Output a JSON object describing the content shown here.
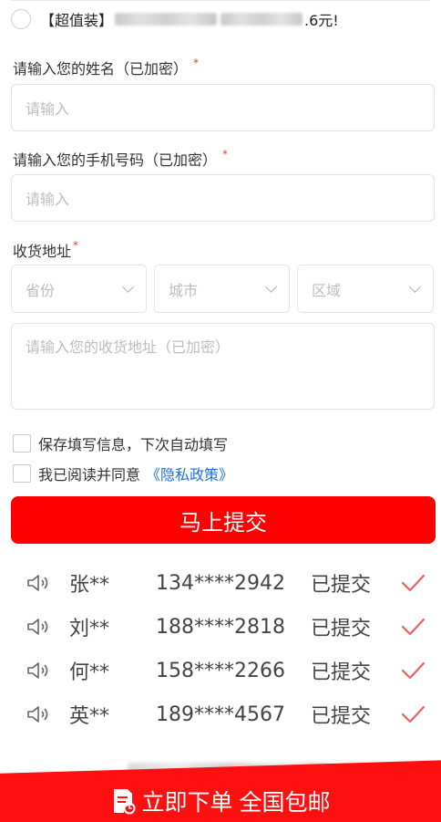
{
  "offer": {
    "prefix": "【超值装】",
    "suffix": ".6元!"
  },
  "form": {
    "name_label": "请输入您的姓名（已加密）",
    "name_placeholder": "请输入",
    "phone_label": "请输入您的手机号码（已加密）",
    "phone_placeholder": "请输入",
    "address_label": "收货地址",
    "required_mark": "*",
    "province": "省份",
    "city": "城市",
    "district": "区域",
    "address_placeholder": "请输入您的收货地址（已加密）",
    "save_info": "保存填写信息，下次自动填写",
    "agree_prefix": "我已阅读并同意",
    "privacy_link": "《隐私政策》",
    "submit": "马上提交"
  },
  "submissions": [
    {
      "name": "张**",
      "phone": "134****2942",
      "status": "已提交"
    },
    {
      "name": "刘**",
      "phone": "188****2818",
      "status": "已提交"
    },
    {
      "name": "何**",
      "phone": "158****2266",
      "status": "已提交"
    },
    {
      "name": "英**",
      "phone": "189****4567",
      "status": "已提交"
    }
  ],
  "bottom_cta": "立即下单 全国包邮",
  "icons": {
    "speaker": "speaker-icon",
    "check": "checkmark-icon",
    "order": "order-document-icon"
  },
  "colors": {
    "accent": "#ff0000",
    "link": "#1e6fe0",
    "required": "#e53935",
    "tick": "#f06262"
  }
}
